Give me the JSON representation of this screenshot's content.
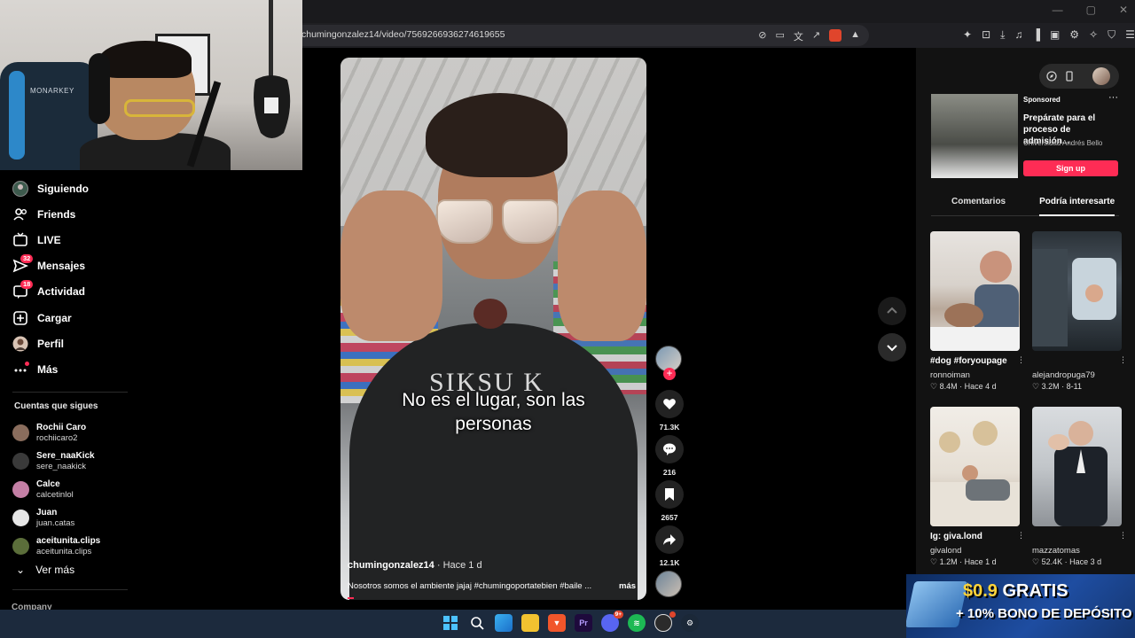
{
  "browser": {
    "url": "chumingonzalez14/video/7569266936274619655",
    "window_controls": [
      "—",
      "▢",
      "✕"
    ],
    "brave_shield_count": "6",
    "rewards_count": "1"
  },
  "nav": {
    "items": [
      {
        "label": "Siguiendo",
        "icon": "following-avatar-icon"
      },
      {
        "label": "Friends",
        "icon": "friends-icon"
      },
      {
        "label": "LIVE",
        "icon": "live-icon"
      },
      {
        "label": "Mensajes",
        "icon": "messages-icon",
        "badge": "32"
      },
      {
        "label": "Actividad",
        "icon": "activity-icon",
        "badge": "18"
      },
      {
        "label": "Cargar",
        "icon": "upload-icon"
      },
      {
        "label": "Perfil",
        "icon": "profile-avatar-icon"
      },
      {
        "label": "Más",
        "icon": "more-icon"
      }
    ],
    "following_title": "Cuentas que sigues",
    "following": [
      {
        "name": "Rochii Caro",
        "user": "rochiicaro2",
        "color": "#8a6d5d"
      },
      {
        "name": "Sere_naaKick",
        "user": "sere_naakick",
        "color": "#3a3a3a"
      },
      {
        "name": "Calce",
        "user": "calcetinlol",
        "color": "#c47fa5"
      },
      {
        "name": "Juan",
        "user": "juan.catas",
        "color": "#e6e6e6"
      },
      {
        "name": "aceitunita.clips",
        "user": "aceitunita.clips",
        "color": "#5b6e3a"
      }
    ],
    "see_more": "Ver más",
    "company": "Company"
  },
  "webcam": {
    "chair_brand": "MONARKEY"
  },
  "video": {
    "subtitle_line1": "No es el lugar, son las",
    "subtitle_line2": "personas",
    "shirt_text": "SIKSU K",
    "author": "chumingonzalez14",
    "time": " · Hace 1 d",
    "caption": "Nosotros somos el ambiente jajaj #chumingoportatebien #baile ...",
    "more": "más",
    "progress": 0.02
  },
  "actions": {
    "likes": "71.3K",
    "comments": "216",
    "saves": "2657",
    "shares": "12.1K"
  },
  "ad": {
    "sponsored": "Sponsored",
    "title": "Prepárate para el proceso de admisión...",
    "advertiser": "Universidad Andrés Bello",
    "cta": "Sign up"
  },
  "tabs": {
    "comments": "Comentarios",
    "suggested": "Podría interesarte"
  },
  "recommended": [
    {
      "title": "#dog #foryoupage",
      "user": "ronnoiman",
      "likes": "8.4M",
      "time": "Hace 4 d"
    },
    {
      "title": "",
      "user": "alejandropuga79",
      "likes": "3.2M",
      "time": "8-11"
    },
    {
      "title": "Ig: giva.lond",
      "user": "givalond",
      "likes": "1.2M",
      "time": "Hace 1 d"
    },
    {
      "title": "",
      "user": "mazzatomas",
      "likes": "52.4K",
      "time": "Hace 3 d"
    }
  ],
  "promo": {
    "amount": "$0.9",
    "gratis": " GRATIS",
    "line2": "+ 10% BONO DE DEPÓSITO"
  },
  "taskbar": {
    "icons": [
      "windows-start-icon",
      "search-icon",
      "widgets-icon",
      "file-explorer-icon",
      "brave-browser-icon",
      "premiere-icon",
      "discord-icon",
      "spotify-icon",
      "obs-icon",
      "steam-icon"
    ],
    "premiere_label": "Pr",
    "discord_badge": "9+"
  },
  "colors": {
    "accent": "#fe2c55",
    "panel": "#121212",
    "taskbar": "#1c2a3d"
  }
}
